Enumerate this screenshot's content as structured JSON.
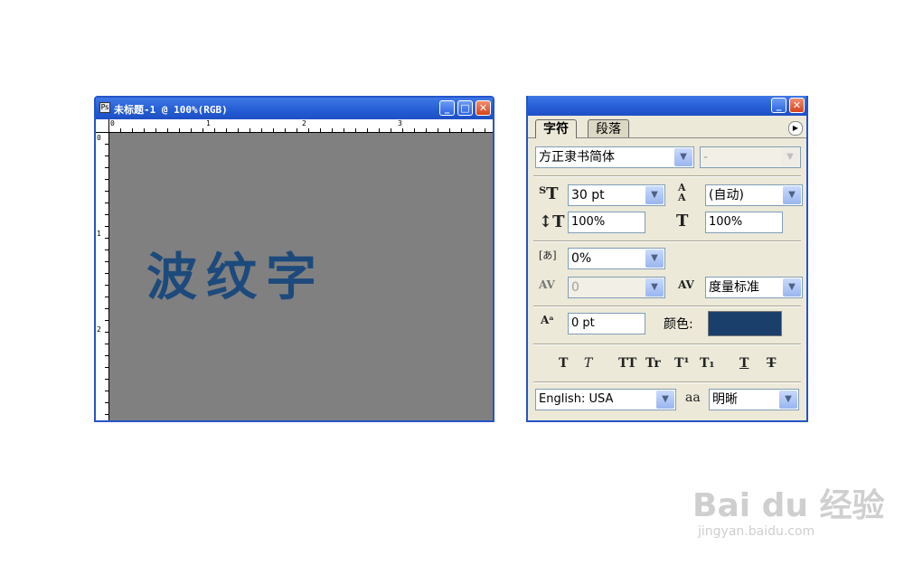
{
  "document": {
    "title": "未标题-1 @ 100%(RGB)",
    "ruler_top_labels": [
      "0",
      "1",
      "2",
      "3"
    ],
    "ruler_left_labels": [
      "0",
      "1",
      "2"
    ],
    "canvas_text": "波纹字",
    "canvas_bg": "#808080",
    "text_color": "#1d4a7c",
    "window_buttons": {
      "minimize": "_",
      "maximize": "□",
      "close": "✕"
    }
  },
  "panel": {
    "tabs": [
      {
        "label": "字符",
        "active": true
      },
      {
        "label": "段落",
        "active": false
      }
    ],
    "menu_icon": "play-right-icon",
    "font_family": "方正隶书简体",
    "font_style": "-",
    "font_size": "30 pt",
    "leading": "(自动)",
    "vertical_scale": "100%",
    "horizontal_scale": "100%",
    "tsume": "0%",
    "kerning": "0",
    "tracking": "度量标准",
    "baseline_shift": "0 pt",
    "color_label": "颜色:",
    "color_value": "#1a3f6b",
    "style_buttons": [
      "T",
      "T",
      "TT",
      "Tr",
      "T¹",
      "T₁",
      "T",
      "T"
    ],
    "language": "English: USA",
    "antialias_icon": "aa",
    "antialias": "明晰"
  },
  "watermark": {
    "logo": "Bai du 经验",
    "url": "jingyan.baidu.com"
  }
}
